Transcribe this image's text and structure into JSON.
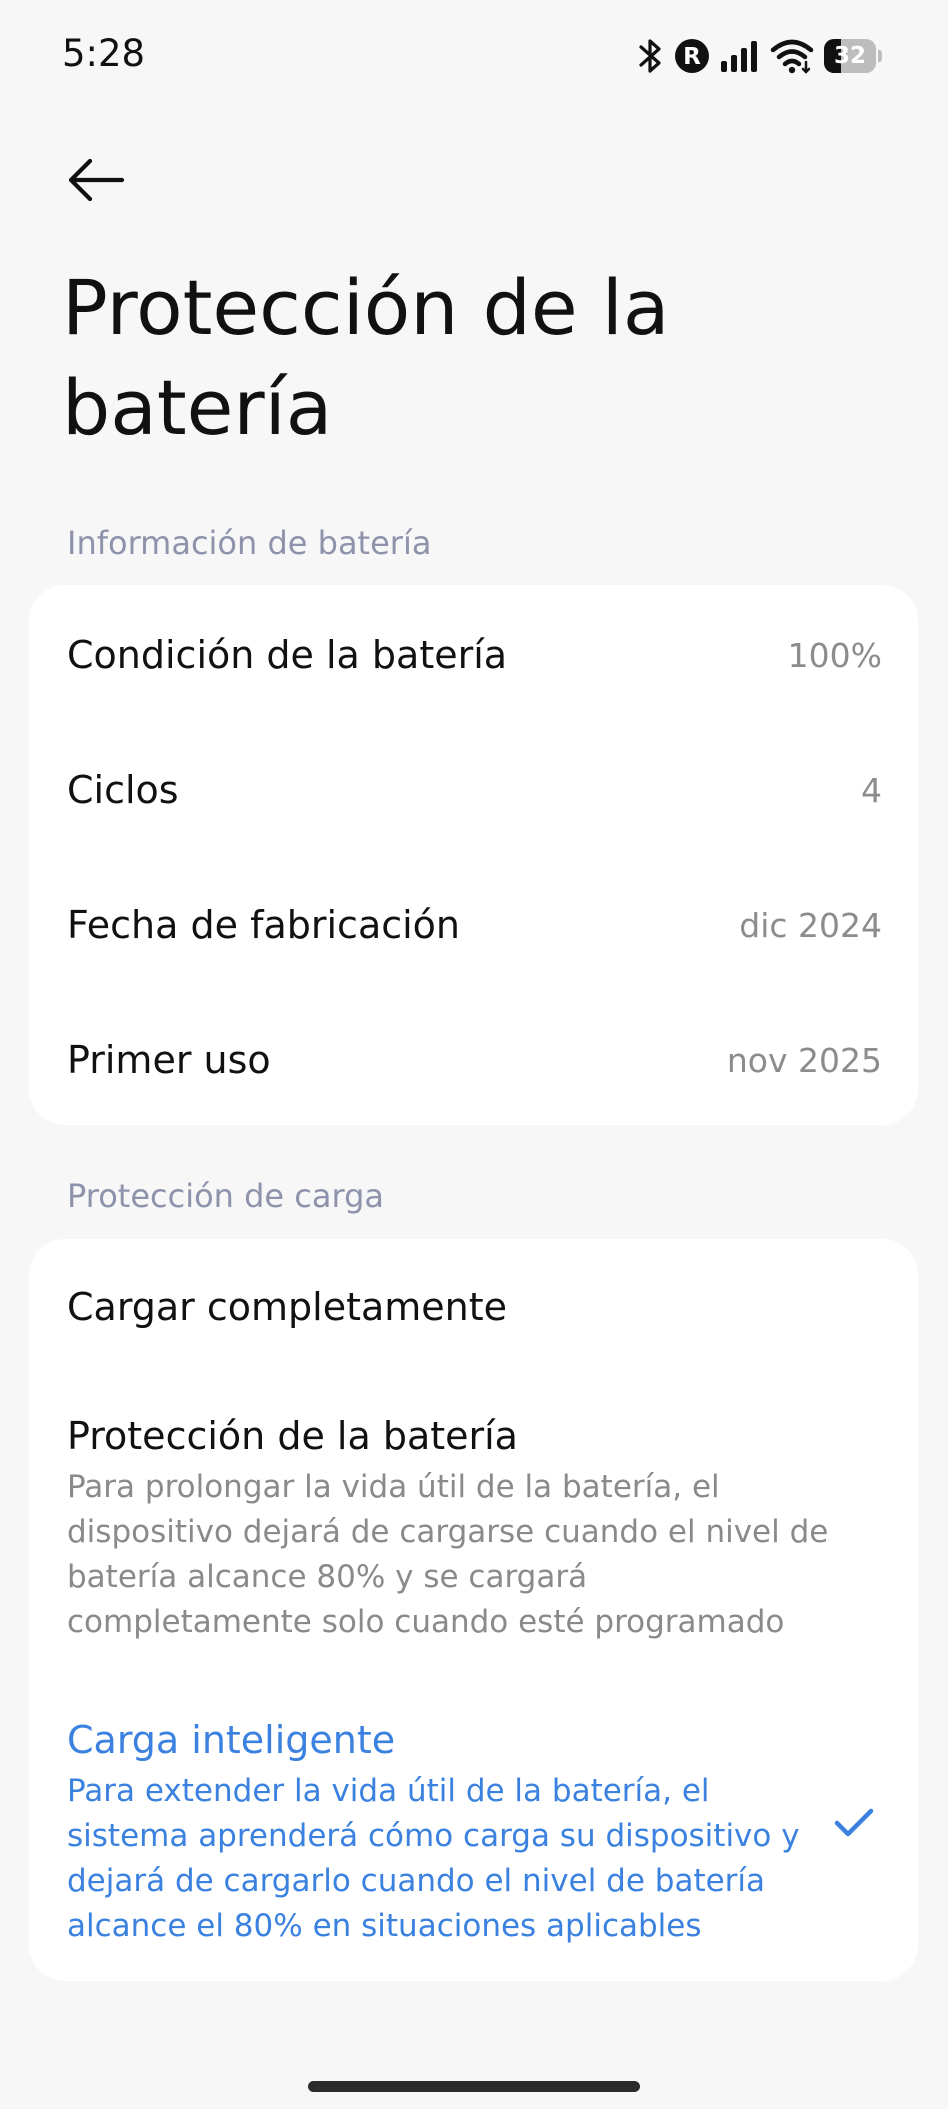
{
  "status_bar": {
    "time": "5:28",
    "icons": [
      "bluetooth-icon",
      "r-badge-icon",
      "signal-icon",
      "wifi-icon",
      "battery-icon"
    ],
    "r_badge": "R",
    "battery_level": "32",
    "battery_fraction": 0.32
  },
  "header": {
    "back_icon": "arrow-left-icon",
    "title": "Protección de la batería"
  },
  "battery_info": {
    "section_title": "Información de batería",
    "rows": [
      {
        "label": "Condición de la batería",
        "value": "100%"
      },
      {
        "label": "Ciclos",
        "value": "4"
      },
      {
        "label": "Fecha de fabricación",
        "value": "dic 2024"
      },
      {
        "label": "Primer uso",
        "value": "nov 2025"
      }
    ]
  },
  "charge_protection": {
    "section_title": "Protección de carga",
    "options": [
      {
        "title": "Cargar completamente",
        "description": "",
        "selected": false
      },
      {
        "title": "Protección de la batería",
        "description": "Para prolongar la vida útil de la batería, el dispositivo dejará de cargarse cuando el nivel de batería alcance 80% y se cargará completamente solo cuando esté programado",
        "selected": false
      },
      {
        "title": "Carga inteligente",
        "description": "Para extender la vida útil de la batería, el sistema aprenderá cómo carga su dispositivo y dejará de cargarlo cuando el nivel de batería alcance el 80% en situaciones aplicables",
        "selected": true
      }
    ]
  },
  "colors": {
    "accent": "#3b82e0",
    "background": "#f7f7f7",
    "card": "#ffffff",
    "section_header": "#8e93ab",
    "secondary_text": "#8a8a8a"
  }
}
